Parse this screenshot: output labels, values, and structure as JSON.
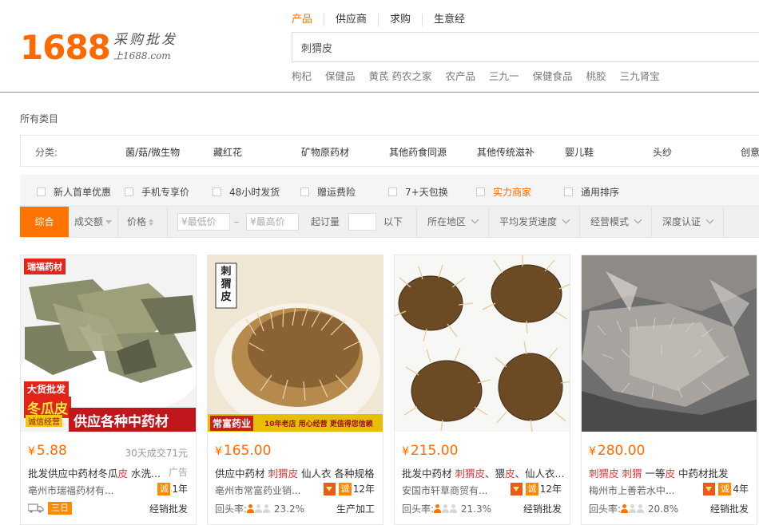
{
  "brand": {
    "logo_number": "1688",
    "logo_cn": "采购批发",
    "logo_domain": "上1688.com"
  },
  "search": {
    "tabs": [
      "产品",
      "供应商",
      "求购",
      "生意经"
    ],
    "query": "刺猬皮",
    "hot_words": [
      "枸杞",
      "保健品",
      "黄芪 药农之家",
      "农产品",
      "三九一",
      "保健食品",
      "桃胶",
      "三九肾宝"
    ]
  },
  "categories": {
    "all_label": "所有类目",
    "label": "分类:",
    "items": [
      "菌/菇/微生物",
      "藏红花",
      "矿物原药材",
      "其他药食同源",
      "其他传统滋补",
      "婴儿鞋",
      "头纱",
      "创意"
    ]
  },
  "filters": [
    "新人首单优惠",
    "手机专享价",
    "48小时发货",
    "赠运费险",
    "7+天包换",
    "实力商家",
    "通用排序"
  ],
  "sort": {
    "general": "综合",
    "volume": "成交额",
    "price": "价格",
    "min_placeholder": "¥最低价",
    "dash": "–",
    "max_placeholder": "¥最高价",
    "moq_label": "起订量",
    "moq_suffix": "以下",
    "region": "所在地区",
    "ship_speed": "平均发货速度",
    "biz_mode": "经营模式",
    "cert": "深度认证"
  },
  "products": [
    {
      "price": "5.88",
      "sold": "30天成交71元",
      "title_parts": [
        "批发供应中药材冬瓜",
        "皮",
        " 水洗..."
      ],
      "ad": "广告",
      "company": "亳州市瑞福药材有...",
      "years": "1年",
      "tag": "三日",
      "biz": "经销批发",
      "img_top_label": "瑞福药材",
      "img_banner_1": "大货批发",
      "img_banner_2": "冬瓜皮",
      "img_banner_3": "诚信经营",
      "img_banner_4": "供应各种中药材"
    },
    {
      "price": "165.00",
      "title_parts": [
        "供应中药材 ",
        "刺猬皮",
        " 仙人衣 各种规格"
      ],
      "company": "亳州市常富药业销...",
      "years": "12年",
      "rate_label": "回头率:",
      "rate": "23.2%",
      "biz": "生产加工",
      "img_label": "刺猬皮",
      "img_banner": "常富药业",
      "img_banner_2": "10年老店 用心经营 更值得您信赖"
    },
    {
      "price": "215.00",
      "title_parts": [
        "批发中药材 ",
        "刺猬皮",
        "、猥",
        "皮",
        "、仙人衣..."
      ],
      "company": "安国市轩草商贸有...",
      "years": "12年",
      "rate_label": "回头率:",
      "rate": "21.3%",
      "biz": "经销批发"
    },
    {
      "price": "280.00",
      "title_parts": [
        "刺猬皮",
        " ",
        "刺猬",
        " 一等",
        "皮",
        " 中药材批发"
      ],
      "company": "梅州市上善若水中...",
      "years": "4年",
      "rate_label": "回头率:",
      "rate": "20.8%",
      "biz": "经销批发"
    }
  ],
  "labels": {
    "yen": "¥",
    "cheng": "诚"
  },
  "colors": {
    "accent": "#ff7300",
    "price": "#ff6a00",
    "highlight": "#e4393c"
  }
}
